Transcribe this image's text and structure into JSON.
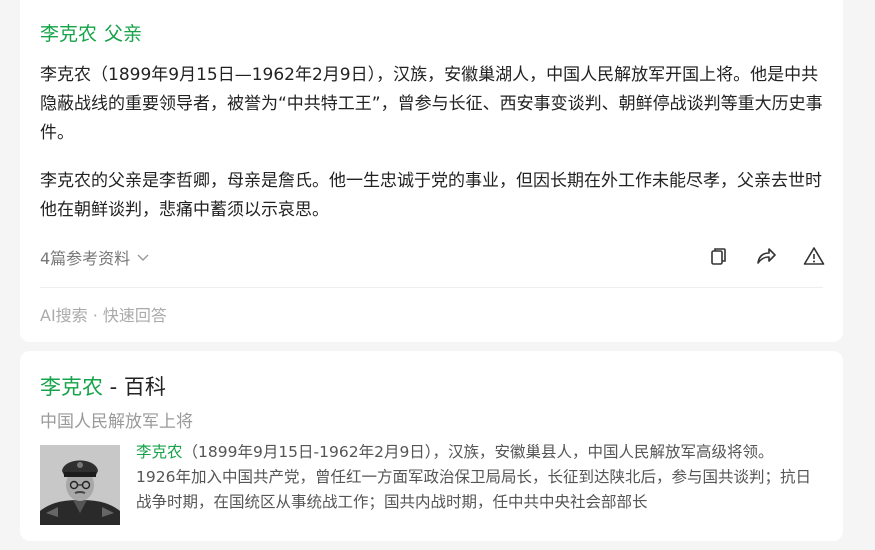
{
  "ai": {
    "title_name": "李克农",
    "title_relation": "父亲",
    "paragraph1": "李克农（1899年9月15日—1962年2月9日），汉族，安徽巢湖人，中国人民解放军开国上将。他是中共隐蔽战线的重要领导者，被誉为“中共特工王”，曾参与长征、西安事变谈判、朝鲜停战谈判等重大历史事件。",
    "paragraph2": "李克农的父亲是李哲卿，母亲是詹氏。他一生忠诚于党的事业，但因长期在外工作未能尽孝，父亲去世时他在朝鲜谈判，悲痛中蓄须以示哀思。",
    "references_label": "4篇参考资料",
    "footer": "AI搜索 · 快速回答",
    "actions": [
      "copy-icon",
      "share-icon",
      "report-icon"
    ]
  },
  "baike": {
    "name": "李克农",
    "title_suffix": " - 百科",
    "subtitle": "中国人民解放军上将",
    "summary_name": "李克农",
    "summary_rest": "（1899年9月15日-1962年2月9日），汉族，安徽巢县人，中国人民解放军高级将领。 1926年加入中国共产党，曾任红一方面军政治保卫局局长，长征到达陕北后，参与国共谈判；抗日战争时期，在国统区从事统战工作；国共内战时期，任中共中央社会部部长",
    "photo_icon": "portrait-photo"
  },
  "colors": {
    "accent": "#16a34a",
    "background": "#f5f5f5"
  }
}
